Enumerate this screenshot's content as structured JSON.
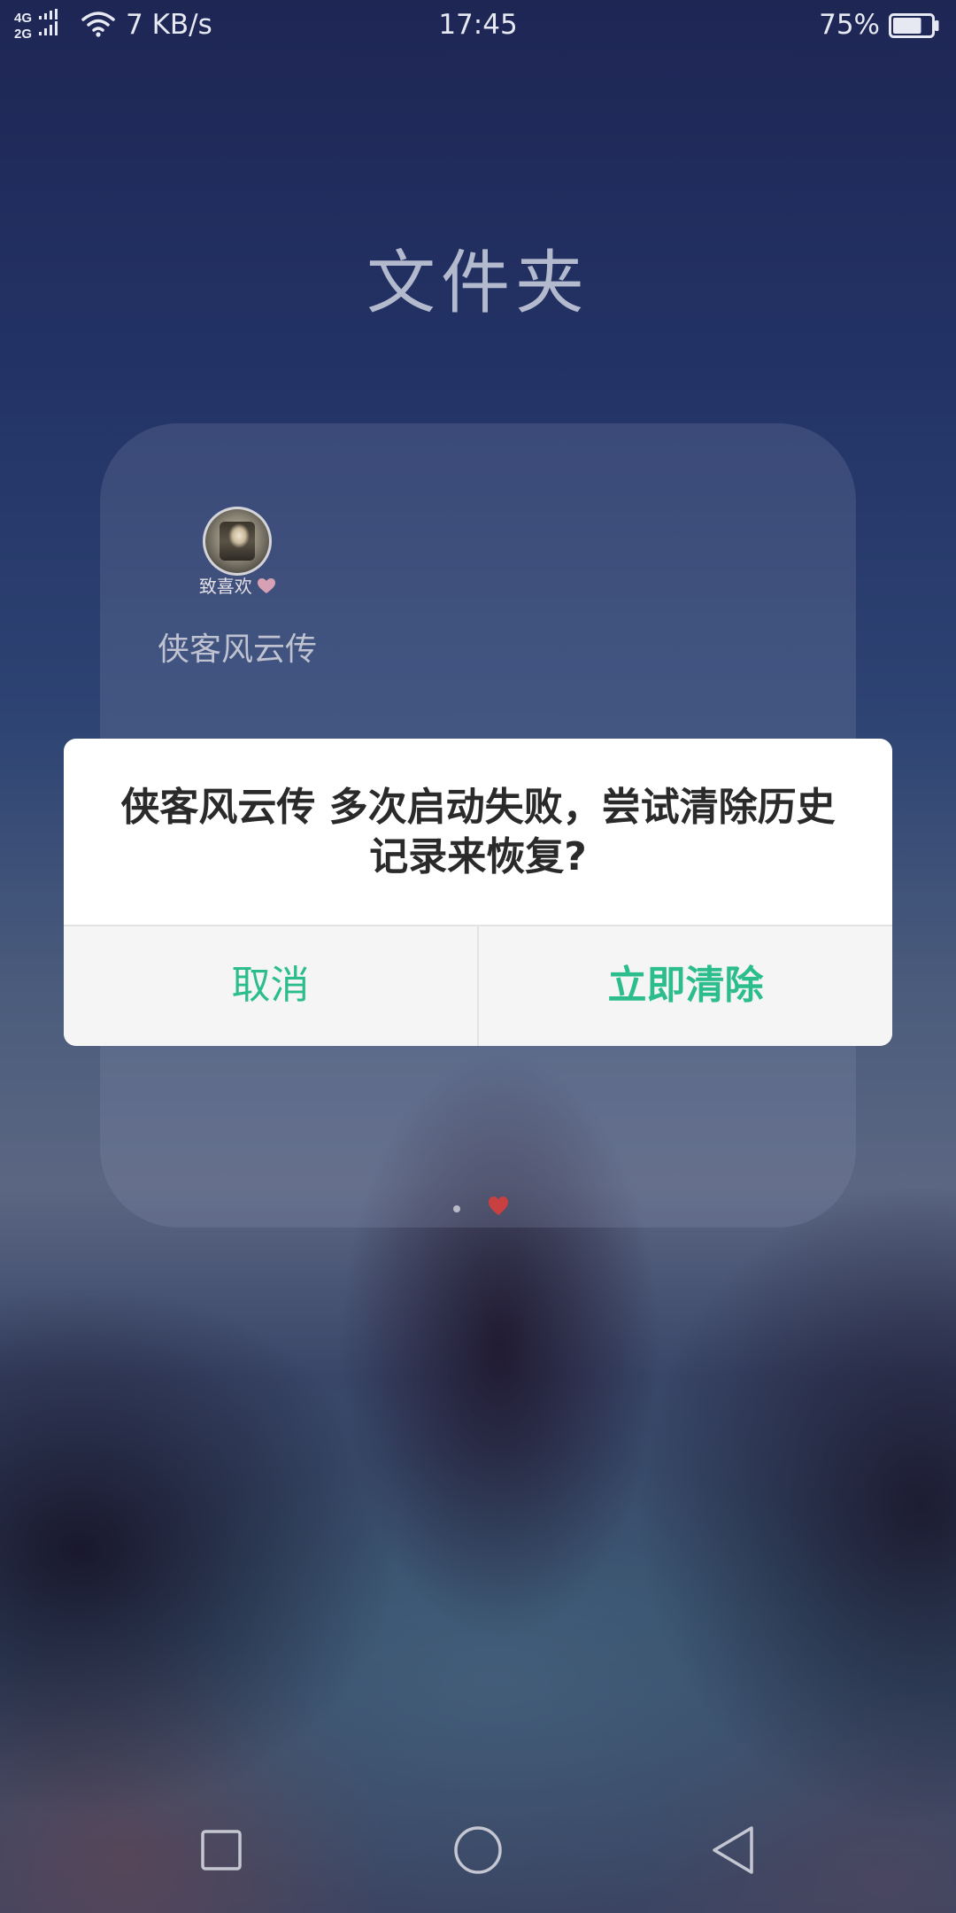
{
  "status_bar": {
    "network_top": "4G",
    "network_bottom": "2G",
    "net_speed": "7 KB/s",
    "clock": "17:45",
    "battery_percent": "75%",
    "battery_level": 0.75
  },
  "folder": {
    "title": "文件夹",
    "app_icon_caption": "致喜欢",
    "app_label": "侠客风云传",
    "page_count": 2,
    "active_page": 2
  },
  "dialog": {
    "message": "侠客风云传 多次启动失败，尝试清除历史记录来恢复?",
    "cancel_label": "取消",
    "confirm_label": "立即清除",
    "accent_color": "#2bbd8c"
  },
  "nav_bar": {
    "icons": [
      "recents-square-icon",
      "home-circle-icon",
      "back-triangle-icon"
    ]
  }
}
